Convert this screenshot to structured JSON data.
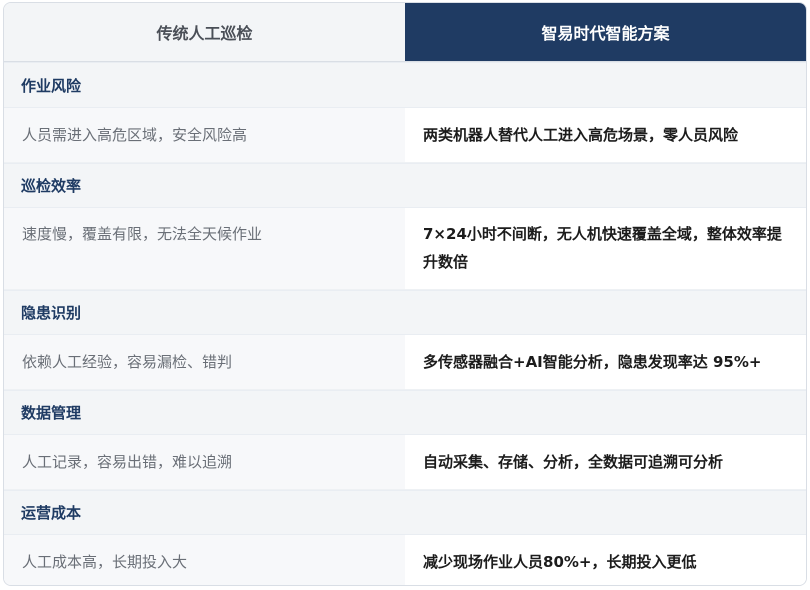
{
  "header": {
    "left": "传统人工巡检",
    "right": "智易时代智能方案"
  },
  "rows": [
    {
      "category": "作业风险",
      "traditional": "人员需进入高危区域，安全风险高",
      "smart": "两类机器人替代人工进入高危场景，零人员风险"
    },
    {
      "category": "巡检效率",
      "traditional": "速度慢，覆盖有限，无法全天候作业",
      "smart": "7×24小时不间断，无人机快速覆盖全域，整体效率提升数倍"
    },
    {
      "category": "隐患识别",
      "traditional": "依赖人工经验，容易漏检、错判",
      "smart": "多传感器融合+AI智能分析，隐患发现率达 95%+"
    },
    {
      "category": "数据管理",
      "traditional": "人工记录，容易出错，难以追溯",
      "smart": "自动采集、存储、分析，全数据可追溯可分析"
    },
    {
      "category": "运营成本",
      "traditional": "人工成本高，长期投入大",
      "smart": "减少现场作业人员80%+，长期投入更低"
    }
  ],
  "colors": {
    "header_dark": "#1f3b63",
    "section_text": "#1f3b63",
    "header_light_bg": "#f3f5f7"
  }
}
